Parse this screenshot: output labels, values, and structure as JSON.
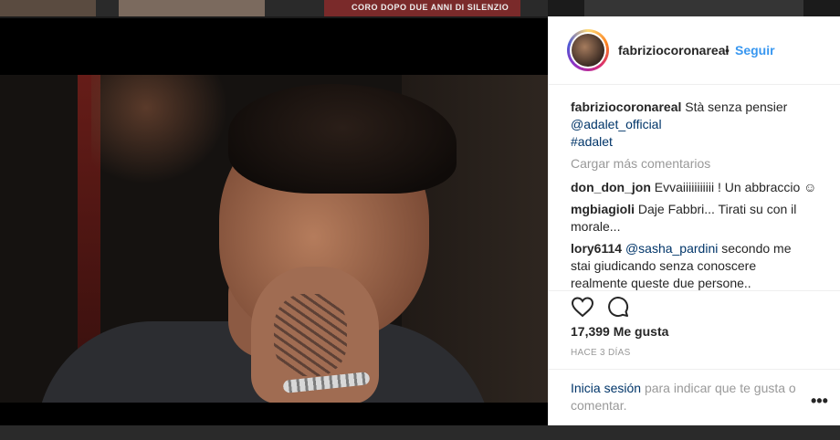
{
  "background": {
    "thumb_text": "DOPO DUE ANNI DI SILENZIO",
    "thumb_brand": "CORO"
  },
  "post": {
    "username": "fabriziocoronareal",
    "follow_label": "Seguir",
    "separator": "•",
    "caption_text": "Stà senza pensier",
    "caption_mention": "@adalet_official",
    "caption_hashtag": "#adalet",
    "load_more": "Cargar más comentarios",
    "comments": [
      {
        "user": "don_don_jon",
        "text": "Evvaiiiiiiiiiii ! Un abbraccio ☺"
      },
      {
        "user": "mgbiagioli",
        "text": "Daje Fabbri... Tirati su con il morale..."
      },
      {
        "user": "lory6114",
        "mention": "@sasha_pardini",
        "text": "secondo me stai giudicando senza conoscere realmente queste due persone.."
      }
    ],
    "likes": "17,399 Me gusta",
    "timestamp": "HACE 3 DÍAS",
    "login_link": "Inicia sesión",
    "login_text": "para indicar que te gusta o comentar.",
    "options": "•••",
    "icons": [
      "heart-icon",
      "comment-icon"
    ]
  }
}
